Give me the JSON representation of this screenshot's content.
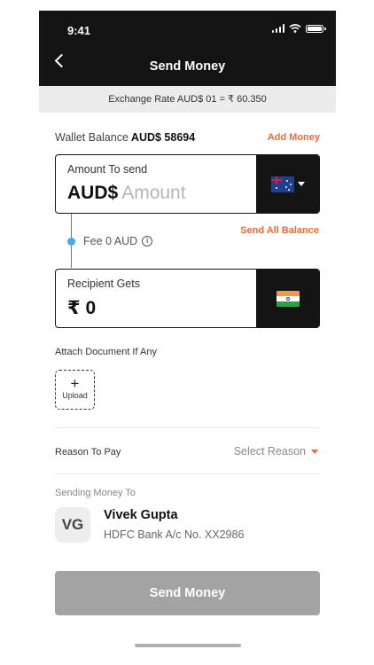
{
  "status": {
    "time": "9:41"
  },
  "header": {
    "title": "Send Money"
  },
  "exchange": {
    "text": "Exchange Rate AUD$ 01 = ₹ 60.350"
  },
  "wallet": {
    "label": "Wallet Balance",
    "value": "AUD$ 58694",
    "add_label": "Add Money"
  },
  "send_card": {
    "label": "Amount To send",
    "currency": "AUD$",
    "placeholder": "Amount",
    "flag_icon": "australia-flag-icon"
  },
  "fee": {
    "text": "Fee 0 AUD",
    "info": "i"
  },
  "send_all": "Send All Balance",
  "recipient_card": {
    "label": "Recipient Gets",
    "value": "₹ 0",
    "flag_icon": "india-flag-icon"
  },
  "attach": {
    "label": "Attach Document If Any",
    "plus": "+",
    "upload": "Upload"
  },
  "reason": {
    "label": "Reason To Pay",
    "select": "Select Reason"
  },
  "recipient": {
    "section_label": "Sending Money To",
    "initials": "VG",
    "name": "Vivek Gupta",
    "bank": "HDFC Bank A/c No. XX2986"
  },
  "actions": {
    "send_label": "Send Money"
  },
  "colors": {
    "dark": "#151414",
    "accent": "#ef6a30",
    "disabled_button": "#a3a3a3",
    "dot": "#47a9e6"
  }
}
